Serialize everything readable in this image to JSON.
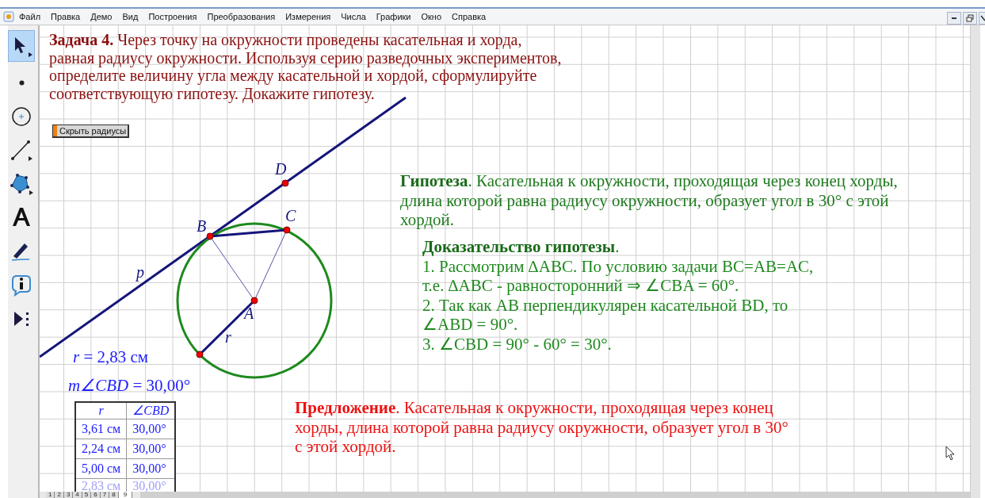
{
  "menu": [
    "Файл",
    "Правка",
    "Демо",
    "Вид",
    "Построения",
    "Преобразования",
    "Измерения",
    "Числа",
    "Графики",
    "Окно",
    "Справка"
  ],
  "tools": [
    {
      "kind": "arrow",
      "selected": true
    },
    {
      "kind": "point",
      "selected": false
    },
    {
      "kind": "compass",
      "selected": false
    },
    {
      "kind": "line",
      "selected": false
    },
    {
      "kind": "polygon",
      "selected": false
    },
    {
      "kind": "text",
      "selected": false
    },
    {
      "kind": "marker",
      "selected": false
    },
    {
      "kind": "info",
      "selected": false
    },
    {
      "kind": "custom",
      "selected": false
    }
  ],
  "task": {
    "lines": [
      "**Задача 4.** Через точку на окружности проведены касательная и хорда,",
      "равная радиусу окружности. Используя серию разведочных экспериментов,",
      "определите величину угла между касательной и хордой, сформулируйте",
      "соответствующую гипотезу. Докажите гипотезу."
    ]
  },
  "hide_button": {
    "label": "Скрыть радиусы"
  },
  "figure": {
    "labels": [
      "D",
      "B",
      "C",
      "A",
      "p",
      "r"
    ]
  },
  "measurements": [
    "*r* = 2,83 см",
    "*m∠CBD* = 30,00°"
  ],
  "table": {
    "columns": [
      "r",
      "∠CBD"
    ],
    "rows": [
      {
        "cells": [
          "3,61 см",
          "30,00°"
        ],
        "faded": false
      },
      {
        "cells": [
          "2,24 см",
          "30,00°"
        ],
        "faded": false
      },
      {
        "cells": [
          "5,00 см",
          "30,00°"
        ],
        "faded": false
      },
      {
        "cells": [
          "2,83 см",
          "30,00°"
        ],
        "faded": true
      }
    ]
  },
  "hypothesis": {
    "lines": [
      "**Гипотеза**. Касательная к окружности, проходящая через конец хорды,",
      "длина которой равна радиусу окружности, образует угол в 30° с этой",
      "хордой."
    ]
  },
  "proof": {
    "lines": [
      "**Доказательство гипотезы**.",
      "1. Рассмотрим ∆ABC. По условию задачи BC=AB=AC,",
      "т.е. ∆ABC - равносторонний ⇒ ∠CBA = 60°.",
      "2. Так как AB перпендикулярен касательной BD, то",
      "∠ABD = 90°.",
      "3. ∠CBD = 90° - 60° = 30°."
    ]
  },
  "proposal": {
    "lines": [
      "**Предложение**. Касательная к окружности, проходящая через конец",
      "хорды, длина которой равна радиусу окружности, образует угол в 30°",
      "с этой хордой."
    ]
  },
  "page_tabs": [
    {
      "label": "1",
      "selected": false
    },
    {
      "label": "2",
      "selected": false
    },
    {
      "label": "3",
      "selected": false
    },
    {
      "label": "4",
      "selected": false
    },
    {
      "label": "5",
      "selected": false
    },
    {
      "label": "6",
      "selected": false
    },
    {
      "label": "7",
      "selected": false
    },
    {
      "label": "8",
      "selected": false
    },
    {
      "label": "9",
      "selected": true
    }
  ]
}
